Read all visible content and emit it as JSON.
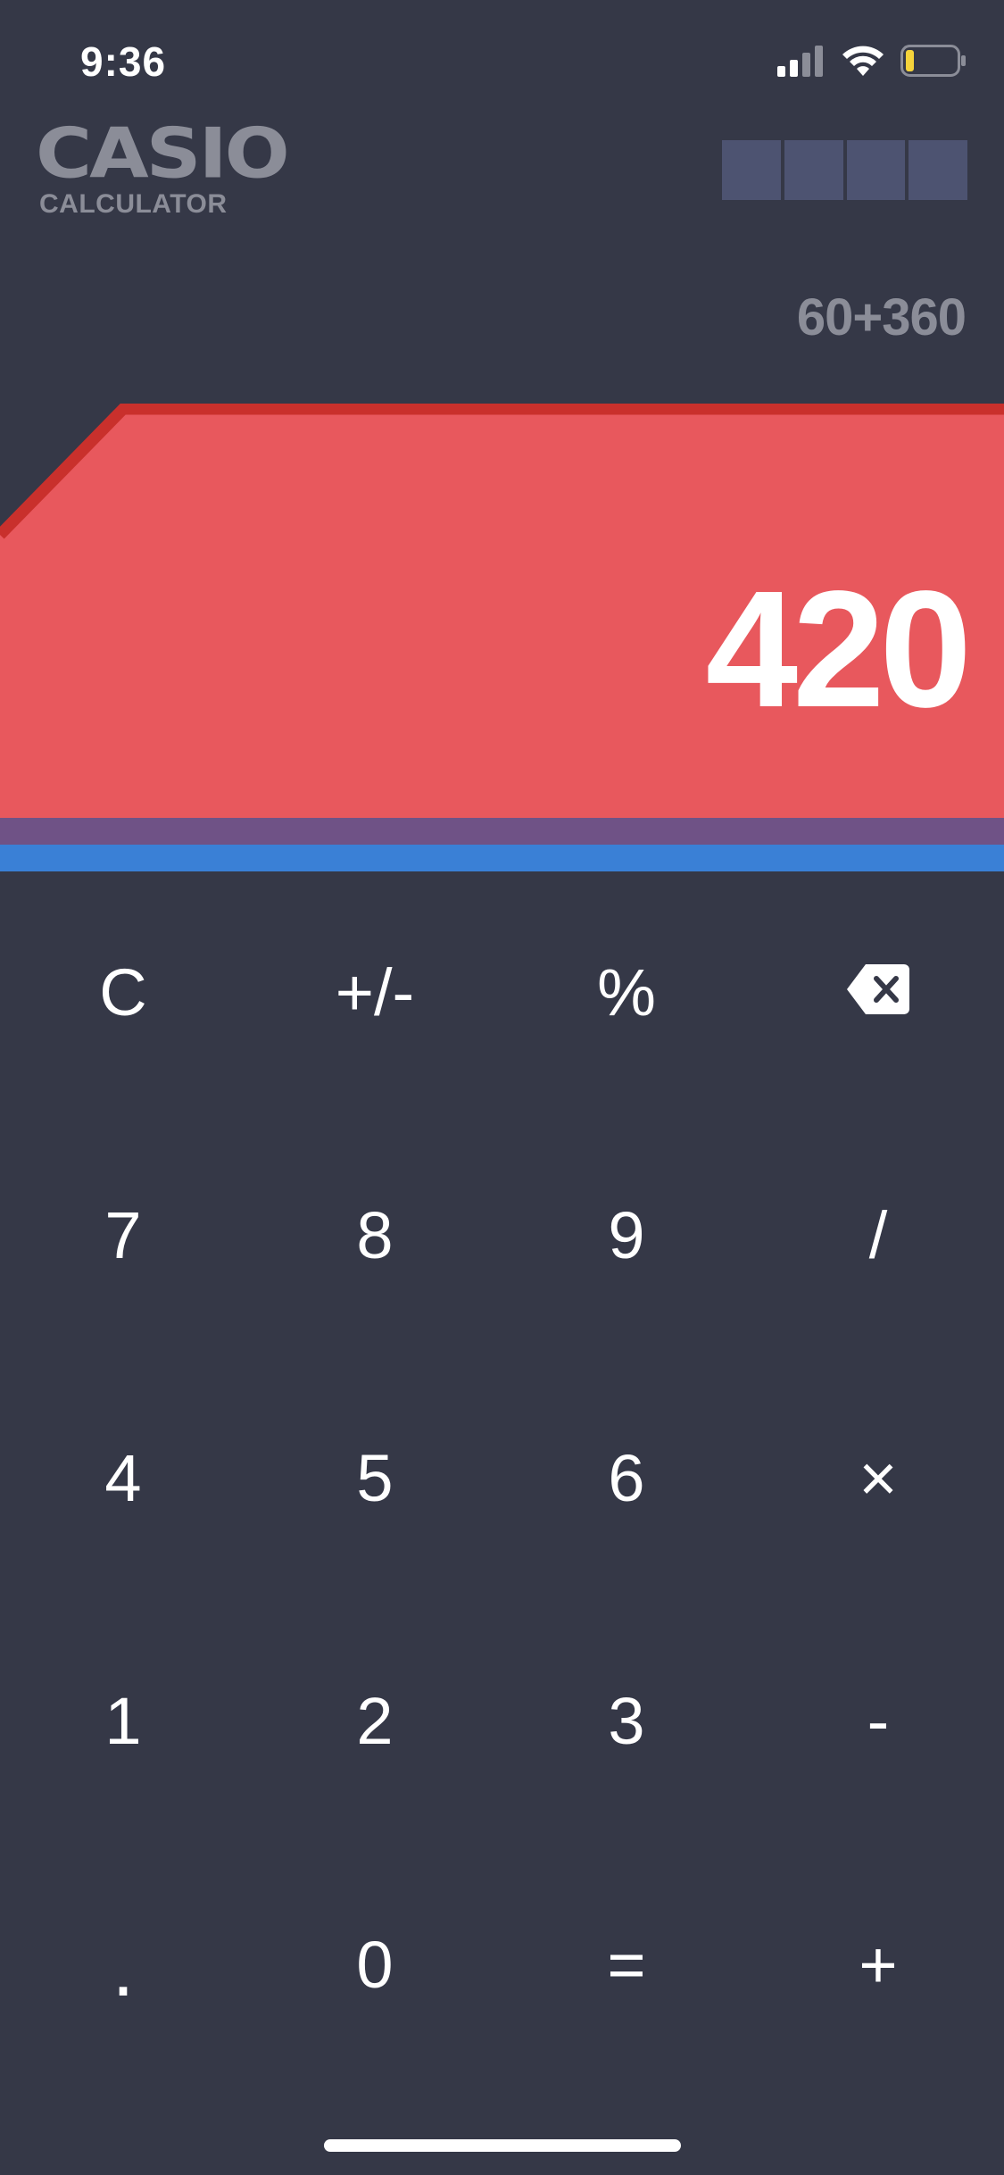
{
  "status_bar": {
    "time": "9:36",
    "icons": [
      "cellular-signal-icon",
      "wifi-icon",
      "battery-icon"
    ],
    "battery_color": "#f5d33b"
  },
  "brand": {
    "name": "CASIO",
    "subtitle": "CALCULATOR"
  },
  "expression": "60+360",
  "display": {
    "value": "420",
    "colors": {
      "panel": "#e8585d",
      "panel_edge": "#c9302c",
      "stripe_purple": "#6f5286",
      "stripe_blue": "#3a80d6"
    }
  },
  "keypad": {
    "rows": [
      [
        {
          "label": "C",
          "name": "clear-button"
        },
        {
          "label": "+/-",
          "name": "sign-toggle-button"
        },
        {
          "label": "%",
          "name": "percent-button"
        },
        {
          "label": "",
          "name": "backspace-button",
          "icon": "backspace-icon"
        }
      ],
      [
        {
          "label": "7",
          "name": "digit-7-button"
        },
        {
          "label": "8",
          "name": "digit-8-button"
        },
        {
          "label": "9",
          "name": "digit-9-button"
        },
        {
          "label": "/",
          "name": "divide-button"
        }
      ],
      [
        {
          "label": "4",
          "name": "digit-4-button"
        },
        {
          "label": "5",
          "name": "digit-5-button"
        },
        {
          "label": "6",
          "name": "digit-6-button"
        },
        {
          "label": "×",
          "name": "multiply-button"
        }
      ],
      [
        {
          "label": "1",
          "name": "digit-1-button"
        },
        {
          "label": "2",
          "name": "digit-2-button"
        },
        {
          "label": "3",
          "name": "digit-3-button"
        },
        {
          "label": "-",
          "name": "subtract-button"
        }
      ],
      [
        {
          "label": ".",
          "name": "decimal-button"
        },
        {
          "label": "0",
          "name": "digit-0-button"
        },
        {
          "label": "=",
          "name": "equals-button"
        },
        {
          "label": "+",
          "name": "add-button"
        }
      ]
    ]
  },
  "colors": {
    "background": "#353847",
    "muted_text": "#8b8d98",
    "solar_cell": "#4d5371"
  }
}
